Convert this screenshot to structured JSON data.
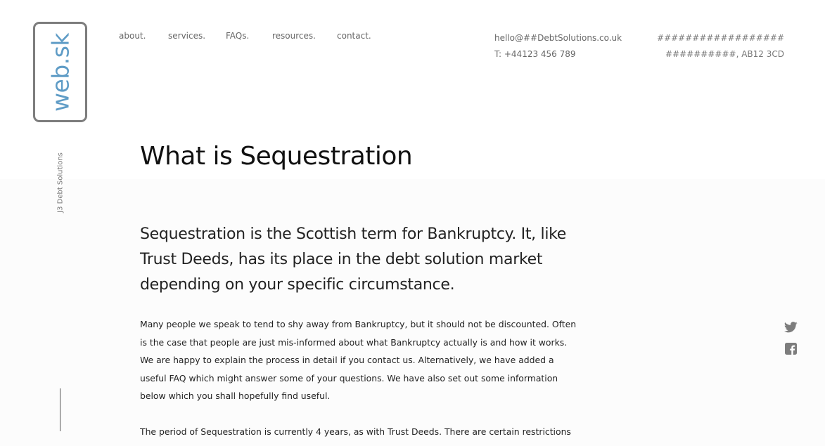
{
  "logo": {
    "text": "web.sk"
  },
  "tagline": "J3 Debt Solutions",
  "nav": {
    "items": [
      {
        "label": "about."
      },
      {
        "label": "services."
      },
      {
        "label": "FAQs."
      },
      {
        "label": "resources."
      },
      {
        "label": "contact."
      }
    ]
  },
  "contact": {
    "email": "hello@##DebtSolutions.co.uk",
    "phone": "T: +44123 456 789"
  },
  "address": {
    "line1": "##################",
    "line2": "##########, AB12 3CD"
  },
  "main": {
    "title": "What is Sequestration",
    "lead": "Sequestration is the Scottish term for Bankruptcy. It, like Trust Deeds, has its place in the debt solution market depending on your specific circumstance.",
    "paragraphs": [
      "Many people we speak to tend to shy away from Bankruptcy, but it should not be discounted. Often is the case that people are just mis-informed about what Bankruptcy actually is and how it works. We are happy to explain the process in detail if you contact us. Alternatively, we have added a useful FAQ which might answer some of your questions. We have also set out some information below which you shall hopefully find useful.",
      "The period of Sequestration is currently 4 years, as with Trust Deeds. There are certain restrictions which"
    ]
  },
  "social": {
    "icons": [
      "twitter-icon",
      "facebook-icon"
    ]
  },
  "colors": {
    "logo_text": "#5f9cc6",
    "logo_border": "#7d7d7d",
    "icon": "#7d7d7d"
  }
}
